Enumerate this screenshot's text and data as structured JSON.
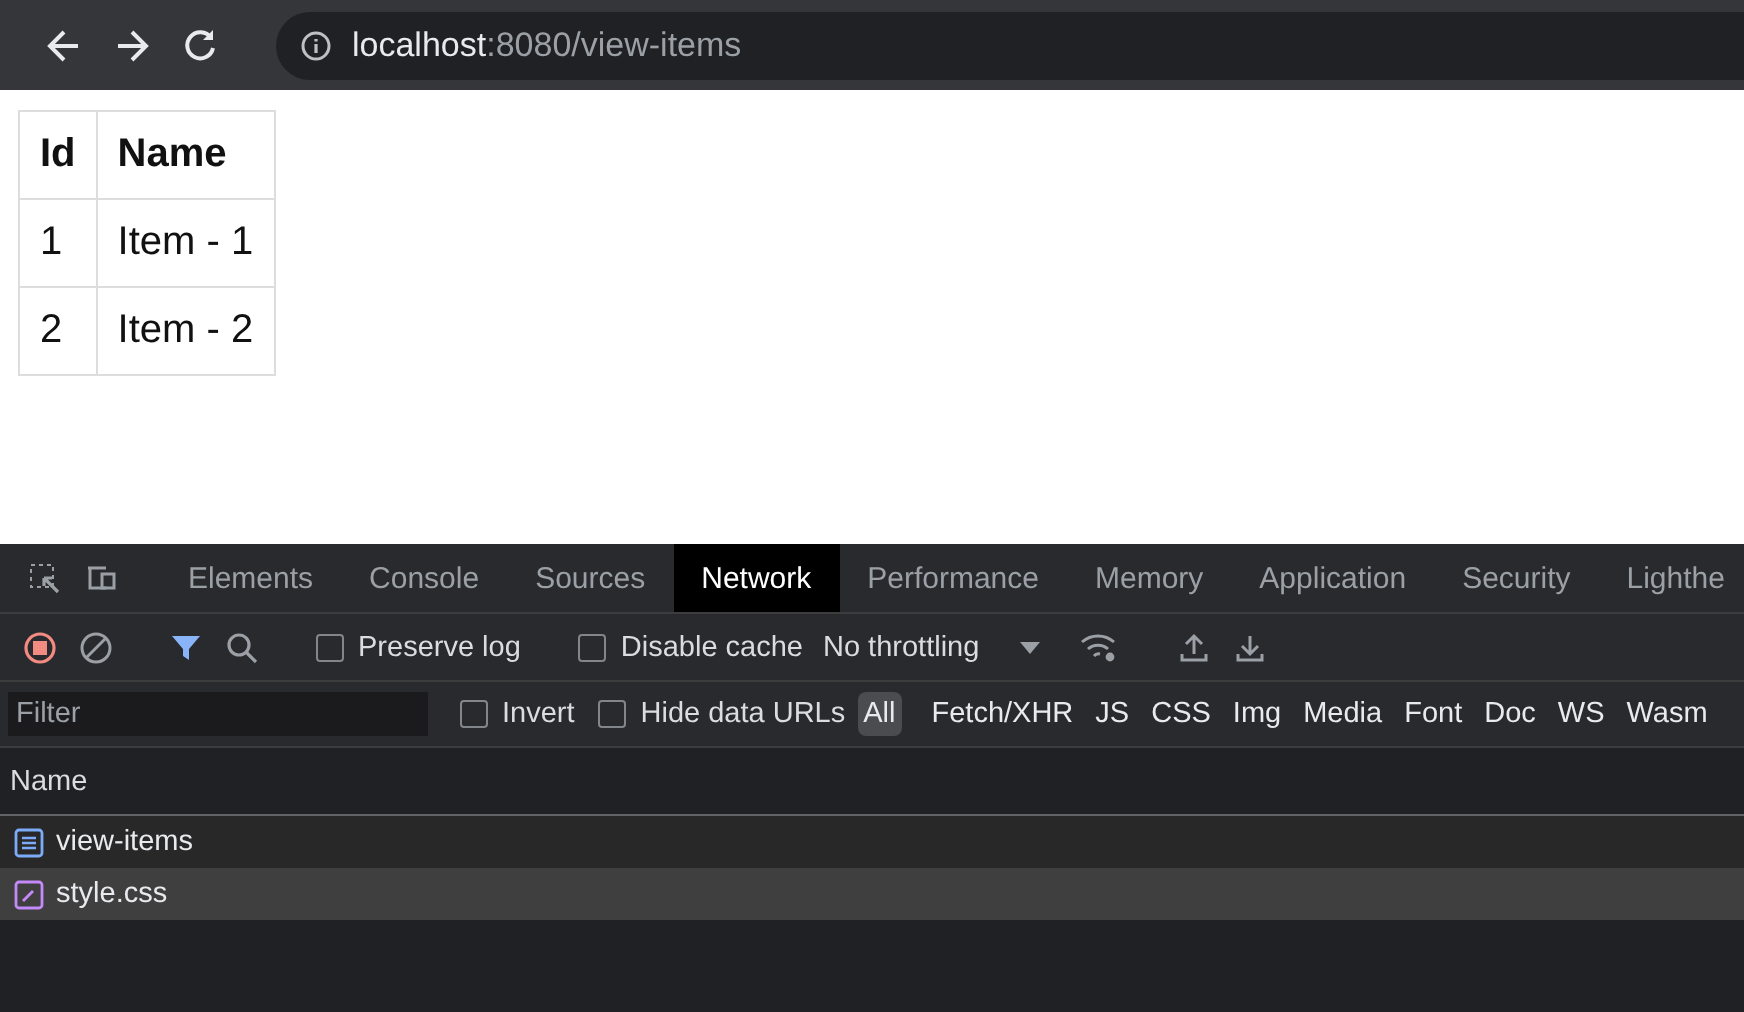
{
  "browser": {
    "url_host": "localhost",
    "url_path": ":8080/view-items"
  },
  "page_table": {
    "columns": [
      "Id",
      "Name"
    ],
    "rows": [
      [
        "1",
        "Item - 1"
      ],
      [
        "2",
        "Item - 2"
      ]
    ]
  },
  "devtools": {
    "tabs": [
      {
        "label": "Elements",
        "selected": false
      },
      {
        "label": "Console",
        "selected": false
      },
      {
        "label": "Sources",
        "selected": false
      },
      {
        "label": "Network",
        "selected": true
      },
      {
        "label": "Performance",
        "selected": false
      },
      {
        "label": "Memory",
        "selected": false
      },
      {
        "label": "Application",
        "selected": false
      },
      {
        "label": "Security",
        "selected": false
      },
      {
        "label": "Lighthe",
        "selected": false
      }
    ],
    "toolbar": {
      "preserve_log": {
        "label": "Preserve log",
        "checked": false
      },
      "disable_cache": {
        "label": "Disable cache",
        "checked": false
      },
      "throttling": "No throttling"
    },
    "filter": {
      "placeholder": "Filter",
      "invert": {
        "label": "Invert",
        "checked": false
      },
      "hide_data_urls": {
        "label": "Hide data URLs",
        "checked": false
      },
      "types": [
        {
          "label": "All",
          "selected": true
        },
        {
          "label": "Fetch/XHR",
          "selected": false
        },
        {
          "label": "JS",
          "selected": false
        },
        {
          "label": "CSS",
          "selected": false
        },
        {
          "label": "Img",
          "selected": false
        },
        {
          "label": "Media",
          "selected": false
        },
        {
          "label": "Font",
          "selected": false
        },
        {
          "label": "Doc",
          "selected": false
        },
        {
          "label": "WS",
          "selected": false
        },
        {
          "label": "Wasm",
          "selected": false
        }
      ]
    },
    "requests": {
      "column": "Name",
      "rows": [
        {
          "name": "view-items",
          "kind": "document",
          "selected": false
        },
        {
          "name": "style.css",
          "kind": "stylesheet",
          "selected": true
        }
      ]
    }
  }
}
